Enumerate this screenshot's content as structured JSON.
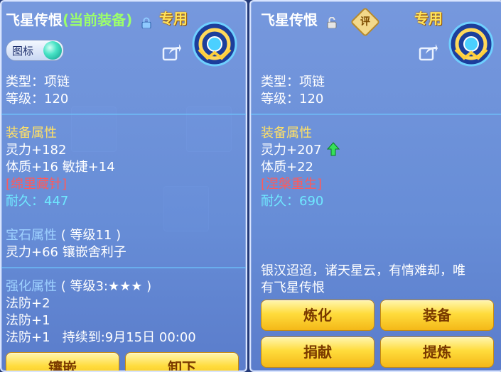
{
  "colors": {
    "accent_yellow": "#ffe066",
    "equipped_green": "#9cff6a",
    "set_red": "#ff5a5a",
    "durability_cyan": "#6fe8ff",
    "button_gold": "#ffdc3c"
  },
  "left_panel": {
    "item_name": "飞星传恨",
    "equipped_tag": "(当前装备)",
    "lock_icon": "lock-icon",
    "exclusive_label": "专用",
    "badge_label": "图标",
    "type_line": "类型：项链",
    "level_line": "等级：120",
    "attr_title": "装备属性",
    "attr_lines": [
      "灵力+182",
      "体质+16 敏捷+14"
    ],
    "set_name": "[绵里藏针]",
    "durability_label": "耐久：",
    "durability_value": "447",
    "gem_title": "宝石属性",
    "gem_level": "( 等级11 )",
    "gem_line": "灵力+66 镶嵌舍利子",
    "enhance_title": "强化属性",
    "enhance_level": "( 等级3:★★★ )",
    "enhance_lines": [
      "法防+2",
      "法防+1"
    ],
    "enhance_last": "法防+1",
    "expiry": "持续到:9月15日 00:00",
    "buttons": [
      "镶嵌",
      "卸下"
    ]
  },
  "right_panel": {
    "item_name": "飞星传恨",
    "lock_icon": "unlock-icon",
    "eval_label": "评",
    "exclusive_label": "专用",
    "type_line": "类型：项链",
    "level_line": "等级：120",
    "attr_title": "装备属性",
    "attr_line_1": "灵力+207",
    "attr_line_2": "体质+22",
    "set_name": "[涅槃重生]",
    "durability_label": "耐久：",
    "durability_value": "690",
    "description_1": "银汉迢迢，诸天星云，有情难却，唯",
    "description_2": "有飞星传恨",
    "buttons": [
      "炼化",
      "装备",
      "捐献",
      "提炼"
    ]
  }
}
